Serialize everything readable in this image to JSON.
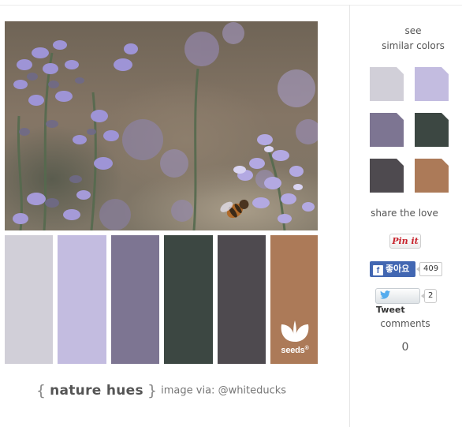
{
  "palette": {
    "swatches": [
      {
        "name": "light-gray",
        "color": "#d1cfd8"
      },
      {
        "name": "lavender",
        "color": "#c3bce0"
      },
      {
        "name": "muted-purple",
        "color": "#7d7592"
      },
      {
        "name": "dark-green-gray",
        "color": "#3c4742"
      },
      {
        "name": "charcoal",
        "color": "#4e4a4f"
      },
      {
        "name": "copper-brown",
        "color": "#ac7a58"
      }
    ],
    "logo_text": "seeds",
    "logo_mark": "®"
  },
  "caption": {
    "open_brace": "{",
    "title": "nature hues",
    "close_brace": "}",
    "credit": "image via: @whiteducks"
  },
  "sidebar": {
    "see_similar_line1": "see",
    "see_similar_line2": "similar colors",
    "mini_swatches": [
      "#d1cfd8",
      "#c3bce0",
      "#7d7592",
      "#3c4742",
      "#4e4a4f",
      "#ac7a58"
    ],
    "share_heading": "share the love",
    "pinit_label": "Pin it",
    "facebook_label": "좋아요",
    "facebook_count": "409",
    "tweet_label": "Tweet",
    "tweet_count": "2",
    "comments_heading": "comments",
    "comments_count": "0"
  }
}
